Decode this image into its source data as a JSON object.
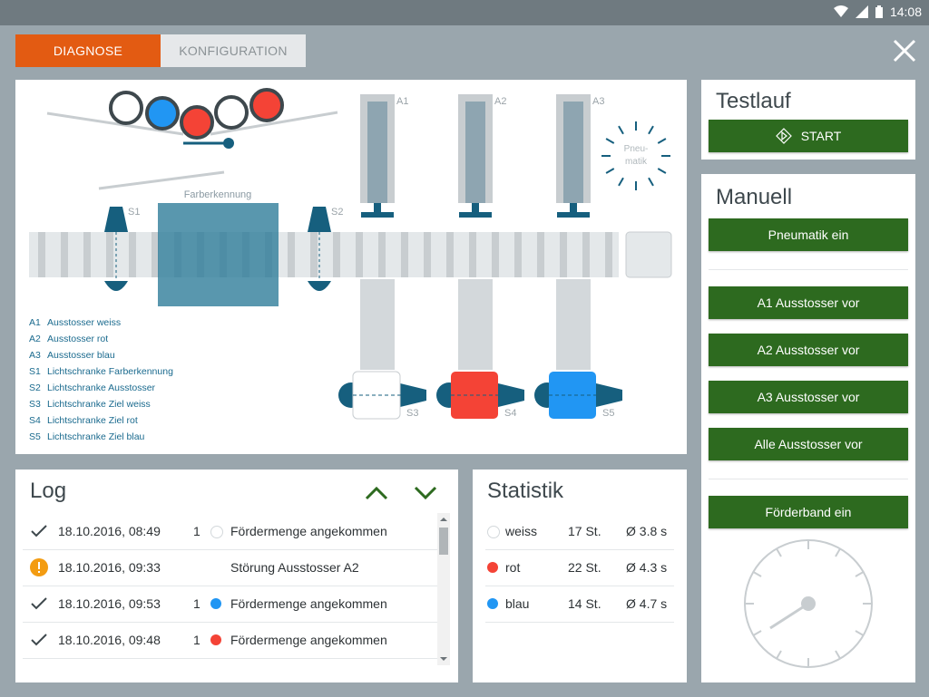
{
  "status": {
    "time": "14:08"
  },
  "tabs": {
    "diagnose": "DIAGNOSE",
    "konfiguration": "KONFIGURATION"
  },
  "diagram": {
    "farbe_label": "Farberkennung",
    "pneumatik_label_1": "Pneu-",
    "pneumatik_label_2": "matik",
    "ejector_labels": [
      "A1",
      "A2",
      "A3"
    ],
    "sensor_labels": [
      "S1",
      "S2",
      "S3",
      "S4",
      "S5"
    ],
    "legend": [
      {
        "code": "A1",
        "text": "Ausstosser weiss"
      },
      {
        "code": "A2",
        "text": "Ausstosser rot"
      },
      {
        "code": "A3",
        "text": "Ausstosser blau"
      },
      {
        "code": "S1",
        "text": "Lichtschranke Farberkennung"
      },
      {
        "code": "S2",
        "text": "Lichtschranke Ausstosser"
      },
      {
        "code": "S3",
        "text": "Lichtschranke Ziel weiss"
      },
      {
        "code": "S4",
        "text": "Lichtschranke Ziel rot"
      },
      {
        "code": "S5",
        "text": "Lichtschranke Ziel blau"
      }
    ]
  },
  "testlauf": {
    "title": "Testlauf",
    "start_label": "START"
  },
  "manuell": {
    "title": "Manuell",
    "pneumatik": "Pneumatik ein",
    "a1": "A1 Ausstosser vor",
    "a2": "A2 Ausstosser vor",
    "a3": "A3 Ausstosser vor",
    "alle": "Alle Ausstosser vor",
    "foerderband": "Förderband ein"
  },
  "log": {
    "title": "Log",
    "rows": [
      {
        "icon": "check-icon",
        "time": "18.10.2016, 08:49",
        "count": "1",
        "color": "#ffffff",
        "message": "Fördermenge angekommen"
      },
      {
        "icon": "warning-icon",
        "time": "18.10.2016, 09:33",
        "count": "",
        "color": "",
        "message": "Störung Ausstosser A2"
      },
      {
        "icon": "check-icon",
        "time": "18.10.2016, 09:53",
        "count": "1",
        "color": "#2196f3",
        "message": "Fördermenge angekommen"
      },
      {
        "icon": "check-icon",
        "time": "18.10.2016, 09:48",
        "count": "1",
        "color": "#f44336",
        "message": "Fördermenge angekommen"
      }
    ]
  },
  "statistik": {
    "title": "Statistik",
    "rows": [
      {
        "color": "#ffffff",
        "name": "weiss",
        "count": "17 St.",
        "avg": "Ø 3.8 s"
      },
      {
        "color": "#f44336",
        "name": "rot",
        "count": "22 St.",
        "avg": "Ø 4.3 s"
      },
      {
        "color": "#2196f3",
        "name": "blau",
        "count": "14 St.",
        "avg": "Ø 4.7 s"
      }
    ]
  },
  "colors": {
    "accent": "#e35b12",
    "button": "#2d6a1f",
    "teal": "#1a6a8e",
    "red": "#f44336",
    "blue": "#2196f3",
    "warning": "#f39c12"
  }
}
